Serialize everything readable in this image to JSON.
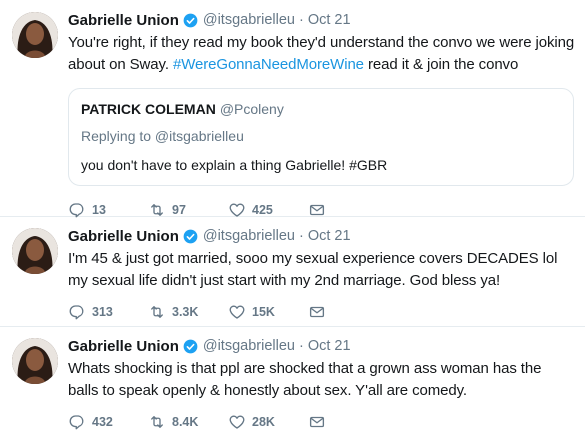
{
  "tweets": [
    {
      "name": "Gabrielle Union",
      "handle": "@itsgabrielleu",
      "separator": "·",
      "date": "Oct 21",
      "text_before": "You're right, if they read my book they'd understand the convo we were joking about on Sway. ",
      "hashtag": "#WereGonnaNeedMoreWine",
      "text_after": " read it & join the convo",
      "quote": {
        "name": "PATRICK COLEMAN",
        "handle": "@Pcoleny",
        "replying": "Replying to @itsgabrielleu",
        "text": "you don't have to explain a thing Gabrielle! #GBR"
      },
      "replies": "13",
      "retweets": "97",
      "likes": "425"
    },
    {
      "name": "Gabrielle Union",
      "handle": "@itsgabrielleu",
      "separator": "·",
      "date": "Oct 21",
      "text": "I'm 45 & just got married, sooo my sexual experience covers DECADES lol my sexual life didn't just start with my 2nd marriage. God bless ya!",
      "replies": "313",
      "retweets": "3.3K",
      "likes": "15K"
    },
    {
      "name": "Gabrielle Union",
      "handle": "@itsgabrielleu",
      "separator": "·",
      "date": "Oct 21",
      "text": "Whats shocking is that ppl are shocked that a grown ass woman has the balls to speak openly & honestly about sex. Y'all are comedy.",
      "replies": "432",
      "retweets": "8.4K",
      "likes": "28K"
    }
  ],
  "colors": {
    "verified": "#1da1f2",
    "hashtag": "#1b95e0",
    "muted": "#657786",
    "divider": "#e6ecf0"
  },
  "icons": {
    "reply": "reply-icon",
    "retweet": "retweet-icon",
    "like": "heart-icon",
    "message": "envelope-icon",
    "verified": "verified-badge-icon"
  }
}
